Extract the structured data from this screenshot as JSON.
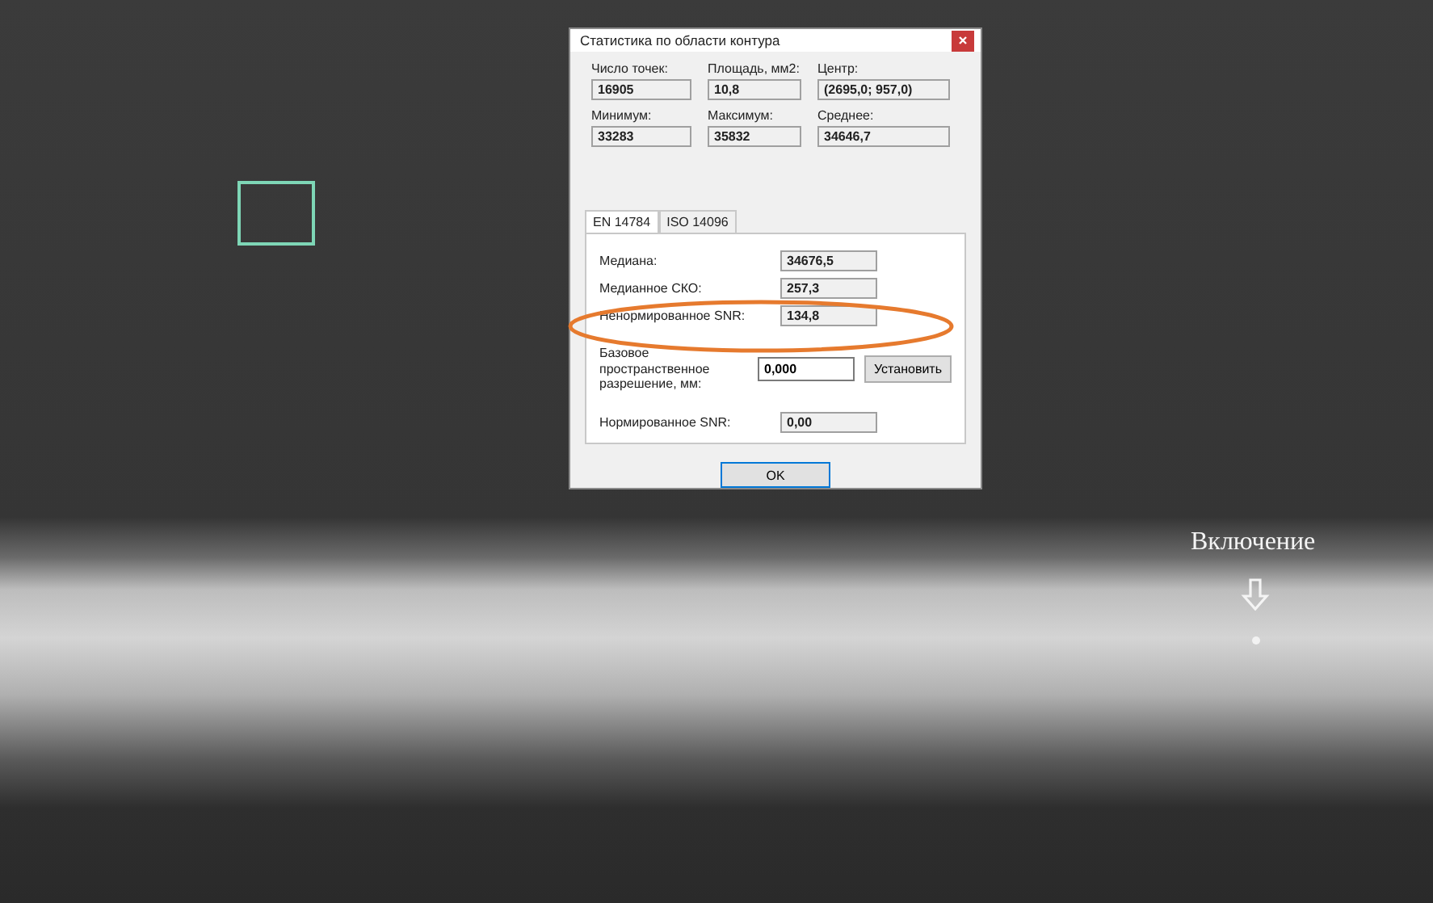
{
  "dialog": {
    "title": "Статистика по области контура",
    "stats": [
      {
        "label": "Число точек:",
        "value": "16905"
      },
      {
        "label": "Площадь, мм2:",
        "value": "10,8"
      },
      {
        "label": "Центр:",
        "value": "(2695,0; 957,0)"
      },
      {
        "label": "Минимум:",
        "value": "33283"
      },
      {
        "label": "Максимум:",
        "value": "35832"
      },
      {
        "label": "Среднее:",
        "value": "34646,7"
      }
    ],
    "tabs": [
      {
        "label": "EN 14784",
        "selected": true
      },
      {
        "label": "ISO 14096",
        "selected": false
      }
    ],
    "rows": [
      {
        "kind": "readonly",
        "label": "Медиана:",
        "value": "34676,5"
      },
      {
        "kind": "readonly",
        "label": "Медианное СКО:",
        "value": "257,3"
      },
      {
        "kind": "readonly",
        "label": "Ненормированное SNR:",
        "value": "134,8"
      },
      {
        "kind": "input",
        "label": "Базовое пространственное разрешение, мм:",
        "value": "0,000",
        "button": "Установить"
      },
      {
        "kind": "readonly",
        "label": "Нормированное SNR:",
        "value": "0,00"
      }
    ],
    "ok_button": "OK"
  },
  "annotation": {
    "label": "Включение"
  }
}
